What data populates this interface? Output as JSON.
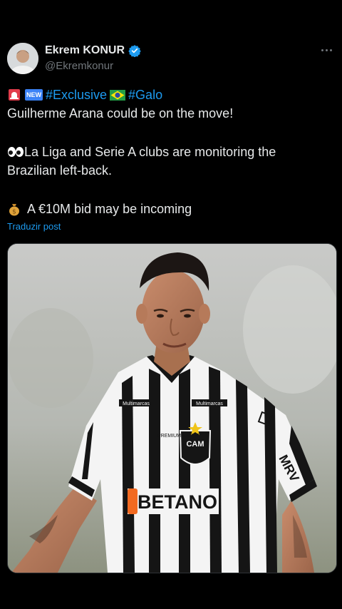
{
  "author": {
    "name": "Ekrem KONUR",
    "handle": "@Ekremkonur"
  },
  "tweet": {
    "line1_new_badge": "NEW",
    "line1_tag_exclusive": "#Exclusive",
    "line1_tag_galo": "#Galo",
    "line2": "Guilherme Arana could be on the move!",
    "line3": "La Liga and Serie A clubs are monitoring the",
    "line4": "Brazilian left-back.",
    "line5": "A €10M bid may be incoming",
    "translate_link": "Traduzir post"
  },
  "media": {
    "shirt_sponsor": "BETANO",
    "sleeve_sponsor": "MRV",
    "badge": "CAM",
    "chest_left": "PREMIUM SAÚDE",
    "chest_logo_a": "Multimarcas",
    "chest_logo_b": "Multimarcas"
  },
  "colors": {
    "accent": "#1d9bf0",
    "background": "#000000",
    "muted": "#71767b"
  },
  "icons": [
    "verified-badge-icon",
    "more-options-icon",
    "siren-emoji-icon",
    "new-emoji-icon",
    "brazil-flag-icon",
    "eyes-emoji-icon",
    "money-bag-emoji-icon"
  ]
}
